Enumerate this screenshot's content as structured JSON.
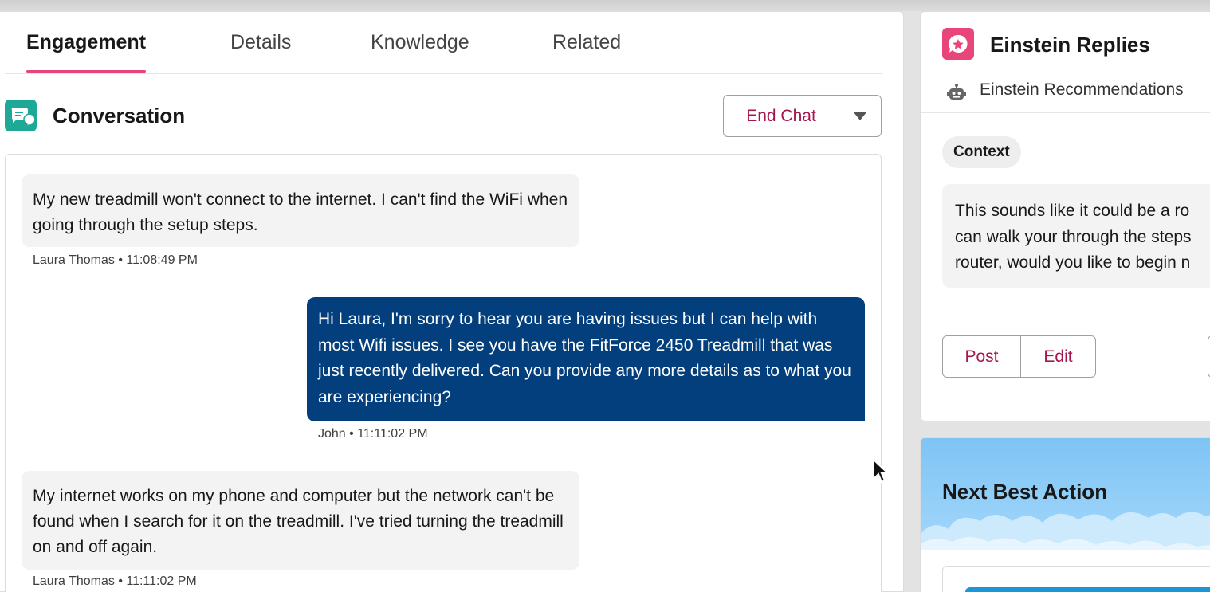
{
  "tabs": [
    {
      "label": "Engagement",
      "active": true
    },
    {
      "label": "Details",
      "active": false
    },
    {
      "label": "Knowledge",
      "active": false
    },
    {
      "label": "Related",
      "active": false
    }
  ],
  "conversation": {
    "title": "Conversation",
    "icon": "chat-icon",
    "end_chat_label": "End Chat",
    "dropdown_icon": "chevron-down-icon",
    "messages": [
      {
        "direction": "incoming",
        "text": "My new treadmill won't connect to the internet. I can't find the WiFi when going through the setup steps.",
        "meta": "Laura Thomas • 11:08:49 PM"
      },
      {
        "direction": "outgoing",
        "text": "Hi Laura, I'm sorry to hear you are having issues but I can help with most Wifi issues. I see you have the FitForce 2450 Treadmill that was just recently delivered. Can you provide any more details as to what you are experiencing?",
        "meta": "John • 11:11:02 PM"
      },
      {
        "direction": "incoming",
        "text": "My internet works on my phone and computer but the network can't be found when I search for it on the treadmill. I've tried turning the treadmill on and off again.",
        "meta": "Laura Thomas • 11:11:02 PM"
      }
    ]
  },
  "einstein": {
    "title": "Einstein Replies",
    "icon": "star-chat-icon",
    "recommendations_label": "Einstein Recommendations",
    "recommendations_icon": "robot-icon",
    "context_label": "Context",
    "context_lines": [
      "This sounds like it could be a ro",
      "can walk your through the steps",
      "router, would you like to begin n"
    ],
    "post_label": "Post",
    "edit_label": "Edit"
  },
  "next_best_action": {
    "title": "Next Best Action"
  },
  "colors": {
    "accent_pink": "#e8457a",
    "brand_red": "#a5164e",
    "outgoing_bubble": "#023f7c",
    "conversation_icon": "#1ea896",
    "sky_banner": "#7ec4f5"
  }
}
